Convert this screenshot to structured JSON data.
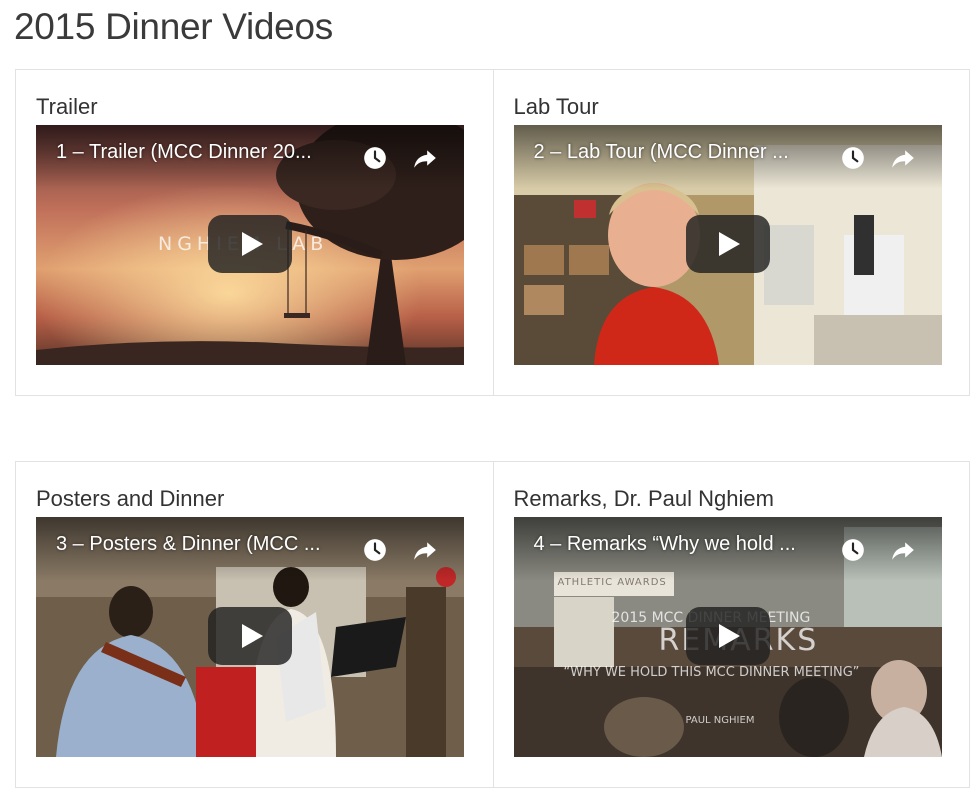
{
  "page": {
    "title": "2015 Dinner Videos"
  },
  "videos": [
    {
      "section_title": "Trailer",
      "player_title": "1 – Trailer (MCC Dinner 20...",
      "overlay": "NGHIEM LAB"
    },
    {
      "section_title": "Lab Tour",
      "player_title": "2 – Lab Tour (MCC Dinner ..."
    },
    {
      "section_title": "Posters and Dinner",
      "player_title": "3 – Posters & Dinner (MCC ..."
    },
    {
      "section_title": "Remarks, Dr. Paul Nghiem",
      "player_title": "4 – Remarks “Why we hold ...",
      "overlay_lines": [
        "2015 MCC DINNER MEETING",
        "REMARKS",
        "“WHY WE HOLD THIS MCC DINNER MEETING”",
        "PAUL NGHIEM"
      ],
      "sign_text": "ATHLETIC AWARDS"
    }
  ],
  "icons": {
    "watch_later": "clock-icon",
    "share": "share-icon",
    "play": "play-icon"
  },
  "colors": {
    "play_button_bg": "#212121",
    "border": "#e2e2e2",
    "title_text": "#333333"
  }
}
